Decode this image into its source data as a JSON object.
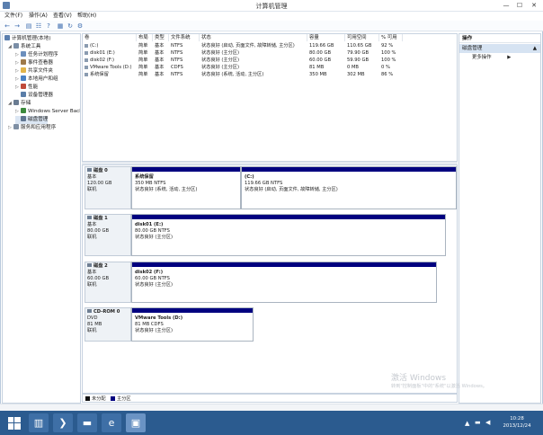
{
  "window": {
    "title": "计算机管理",
    "minimize": "—",
    "maximize": "☐",
    "close": "✕"
  },
  "menu": [
    "文件(F)",
    "操作(A)",
    "查看(V)",
    "帮助(H)"
  ],
  "tree": {
    "root": "计算机管理(本地)",
    "items": [
      {
        "label": "系统工具",
        "level": 1,
        "expand": "◢",
        "icon": "tools-icon",
        "color": "#7a8ea6"
      },
      {
        "label": "任务计划程序",
        "level": 2,
        "expand": "▷",
        "icon": "clock-icon",
        "color": "#6c8fbd"
      },
      {
        "label": "事件查看器",
        "level": 2,
        "expand": "▷",
        "icon": "event-viewer-icon",
        "color": "#9e7a4a"
      },
      {
        "label": "共享文件夹",
        "level": 2,
        "expand": "▷",
        "icon": "shared-folder-icon",
        "color": "#e2b54a"
      },
      {
        "label": "本地用户和组",
        "level": 2,
        "expand": "▷",
        "icon": "users-icon",
        "color": "#4a82c4"
      },
      {
        "label": "性能",
        "level": 2,
        "expand": "▷",
        "icon": "performance-icon",
        "color": "#c04a3a"
      },
      {
        "label": "设备管理器",
        "level": 2,
        "expand": "",
        "icon": "device-manager-icon",
        "color": "#5a7da8"
      },
      {
        "label": "存储",
        "level": 1,
        "expand": "◢",
        "icon": "storage-icon",
        "color": "#6a7c92"
      },
      {
        "label": "Windows Server Back",
        "level": 2,
        "expand": "▷",
        "icon": "backup-icon",
        "color": "#3c8a3c"
      },
      {
        "label": "磁盘管理",
        "level": 2,
        "expand": "",
        "icon": "disk-management-icon",
        "color": "#5f7590"
      },
      {
        "label": "服务和应用程序",
        "level": 1,
        "expand": "▷",
        "icon": "services-icon",
        "color": "#7e8fa4"
      }
    ]
  },
  "volume_list": {
    "headers": [
      "卷",
      "布局",
      "类型",
      "文件系统",
      "状态",
      "容量",
      "可用空间",
      "% 可用"
    ],
    "rows": [
      [
        "(C:)",
        "简单",
        "基本",
        "NTFS",
        "状态良好 (启动, 页面文件, 故障转储, 主分区)",
        "119.66 GB",
        "110.65 GB",
        "92 %"
      ],
      [
        "disk01 (E:)",
        "简单",
        "基本",
        "NTFS",
        "状态良好 (主分区)",
        "80.00 GB",
        "79.90 GB",
        "100 %"
      ],
      [
        "disk02 (F:)",
        "简单",
        "基本",
        "NTFS",
        "状态良好 (主分区)",
        "60.00 GB",
        "59.90 GB",
        "100 %"
      ],
      [
        "VMware Tools (D:)",
        "简单",
        "基本",
        "CDFS",
        "状态良好 (主分区)",
        "81 MB",
        "0 MB",
        "0 %"
      ],
      [
        "系统保留",
        "简单",
        "基本",
        "NTFS",
        "状态良好 (系统, 活动, 主分区)",
        "350 MB",
        "302 MB",
        "86 %"
      ]
    ]
  },
  "disks": [
    {
      "name": "磁盘 0",
      "type": "基本",
      "size": "120.00 GB",
      "status": "联机",
      "partitions": [
        {
          "name": "系统保留",
          "size": "350 MB NTFS",
          "status": "状态良好 (系统, 活动, 主分区)"
        },
        {
          "name": "(C:)",
          "size": "119.66 GB NTFS",
          "status": "状态良好 (启动, 页面文件, 故障转储, 主分区)"
        }
      ]
    },
    {
      "name": "磁盘 1",
      "type": "基本",
      "size": "80.00 GB",
      "status": "联机",
      "partitions": [
        {
          "name": "disk01 (E:)",
          "size": "80.00 GB NTFS",
          "status": "状态良好 (主分区)"
        }
      ]
    },
    {
      "name": "磁盘 2",
      "type": "基本",
      "size": "60.00 GB",
      "status": "联机",
      "partitions": [
        {
          "name": "disk02 (F:)",
          "size": "60.00 GB NTFS",
          "status": "状态良好 (主分区)"
        }
      ]
    },
    {
      "name": "CD-ROM 0",
      "type": "DVD",
      "size": "81 MB",
      "status": "联机",
      "partitions": [
        {
          "name": "VMware Tools (D:)",
          "size": "81 MB CDFS",
          "status": "状态良好 (主分区)"
        }
      ]
    }
  ],
  "legend": [
    {
      "label": "未分配",
      "color": "#111111"
    },
    {
      "label": "主分区",
      "color": "#00007f"
    }
  ],
  "actions": {
    "header": "操作",
    "section": "磁盘管理",
    "more": "更多操作"
  },
  "watermark": {
    "line1": "激活 Windows",
    "line2": "转到\"控制面板\"中的\"系统\"以激活 Windows。"
  },
  "tray": {
    "time": "10:28",
    "date": "2013/12/24"
  }
}
